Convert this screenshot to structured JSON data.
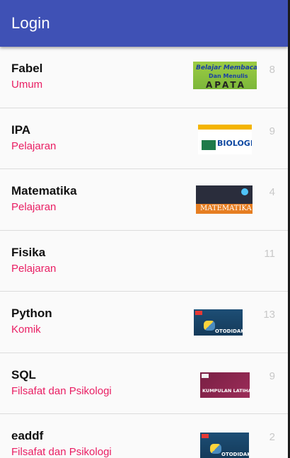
{
  "app": {
    "title": "Login"
  },
  "books": [
    {
      "title": "Fabel",
      "category": "Umum",
      "count": "8",
      "cover_icon": "fabel-cover-icon"
    },
    {
      "title": "IPA",
      "category": "Pelajaran",
      "count": "9",
      "cover_icon": "biologi-cover-icon"
    },
    {
      "title": "Matematika",
      "category": "Pelajaran",
      "count": "4",
      "cover_icon": "matematika-cover-icon"
    },
    {
      "title": "Fisika",
      "category": "Pelajaran",
      "count": "11"
    },
    {
      "title": "Python",
      "category": "Komik",
      "count": "13",
      "cover_icon": "python-cover-icon"
    },
    {
      "title": "SQL",
      "category": "Filsafat dan Psikologi",
      "count": "9",
      "cover_icon": "kumpulan-latihan-cover-icon"
    },
    {
      "title": "eaddf",
      "category": "Filsafat dan Psikologi",
      "count": "2",
      "cover_icon": "python-cover-icon"
    }
  ],
  "covers": {
    "fabel_line1": "Belajar Membaca",
    "fabel_line2": "Dan Menulis",
    "fabel_line3": "APATA",
    "biologi": "BIOLOGI",
    "matematika": "MATEMATIKA",
    "python": "OTODIDAK",
    "sql": "KUMPULAN LATIHAN"
  },
  "colors": {
    "app_bar": "#3f51b5",
    "subtitle": "#e91e63",
    "count": "#c8c8c8"
  }
}
